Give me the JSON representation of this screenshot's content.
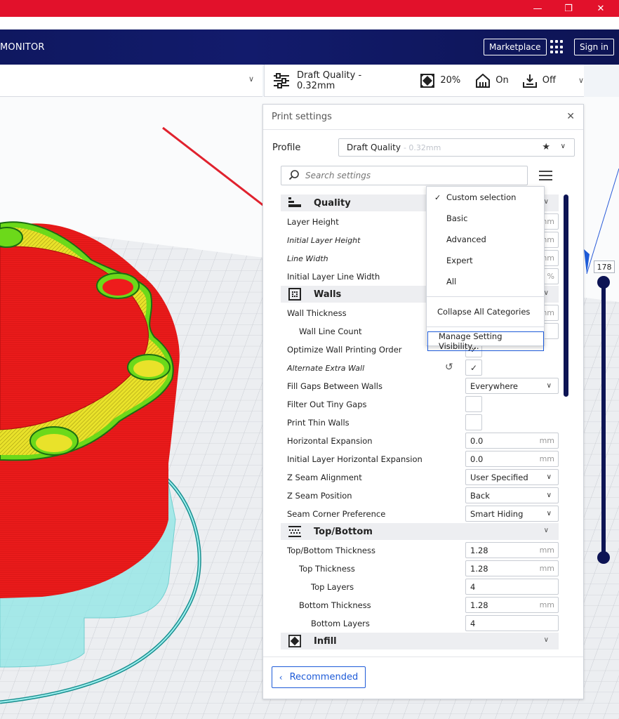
{
  "window": {
    "minimize_glyph": "—",
    "restore_glyph": "❐",
    "close_glyph": "✕"
  },
  "header": {
    "stage_label": "MONITOR",
    "marketplace_label": "Marketplace",
    "signin_label": "Sign in"
  },
  "printbar": {
    "profile": "Draft Quality - 0.32mm",
    "infill": "20%",
    "support": "On",
    "adhesion": "Off"
  },
  "panel": {
    "title": "Print settings",
    "profile_label": "Profile",
    "profile_value": "Draft Quality",
    "profile_sub": "- 0.32mm",
    "search_placeholder": "Search settings",
    "recommended_label": "Recommended"
  },
  "categories": {
    "quality": "Quality",
    "walls": "Walls",
    "topbottom": "Top/Bottom",
    "infill": "Infill"
  },
  "settings": {
    "layer_height": "Layer Height",
    "initial_layer_height": "Initial Layer Height",
    "line_width": "Line Width",
    "initial_layer_line_width": "Initial Layer Line Width",
    "wall_thickness": "Wall Thickness",
    "wall_line_count": "Wall Line Count",
    "optimize_wall_order": "Optimize Wall Printing Order",
    "alternate_extra_wall": "Alternate Extra Wall",
    "fill_gaps": "Fill Gaps Between Walls",
    "fill_gaps_value": "Everywhere",
    "filter_tiny_gaps": "Filter Out Tiny Gaps",
    "print_thin_walls": "Print Thin Walls",
    "horizontal_expansion": "Horizontal Expansion",
    "horizontal_expansion_value": "0.0",
    "initial_layer_h_expansion": "Initial Layer Horizontal Expansion",
    "initial_layer_h_expansion_value": "0.0",
    "z_seam_alignment": "Z Seam Alignment",
    "z_seam_alignment_value": "User Specified",
    "z_seam_position": "Z Seam Position",
    "z_seam_position_value": "Back",
    "seam_corner_pref": "Seam Corner Preference",
    "seam_corner_pref_value": "Smart Hiding",
    "topbottom_thickness": "Top/Bottom Thickness",
    "topbottom_thickness_value": "1.28",
    "top_thickness": "Top Thickness",
    "top_thickness_value": "1.28",
    "top_layers": "Top Layers",
    "top_layers_value": "4",
    "bottom_thickness": "Bottom Thickness",
    "bottom_thickness_value": "1.28",
    "bottom_layers": "Bottom Layers",
    "bottom_layers_value": "4",
    "unit_mm": "mm",
    "unit_pct": "%",
    "check_glyph": "✓"
  },
  "menu": {
    "custom_selection": "Custom selection",
    "basic": "Basic",
    "advanced": "Advanced",
    "expert": "Expert",
    "all": "All",
    "collapse_all": "Collapse All Categories",
    "manage_visibility": "Manage Setting Visibility..."
  },
  "layer_slider": {
    "value": "178"
  },
  "colors": {
    "accent": "#1e5bd8",
    "navy": "#0d1454",
    "titlebar_red": "#e2112b",
    "model_red": "#ee1c1c",
    "model_green": "#6cd91a",
    "model_yellow": "#e9e22a",
    "support_cyan": "#7fe6e6",
    "annotation_arrow": "#e0222e"
  }
}
